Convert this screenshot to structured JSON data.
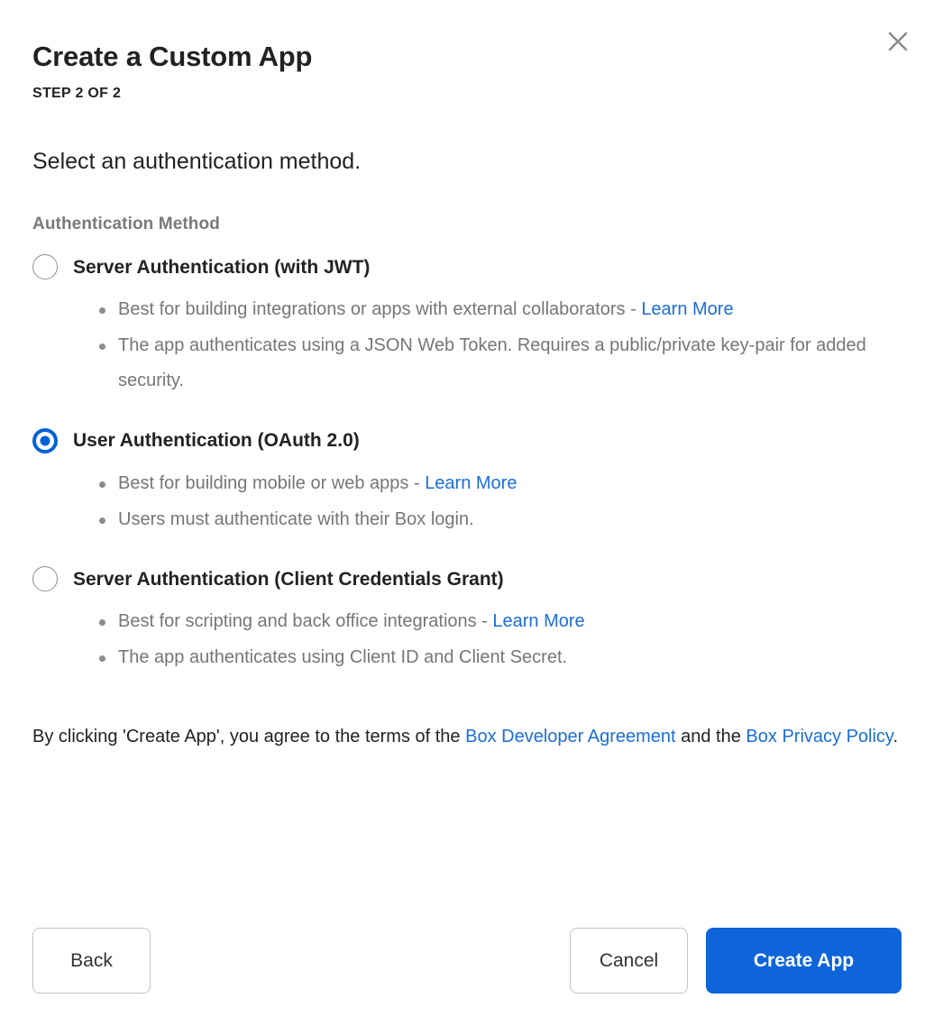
{
  "dialog": {
    "title": "Create a Custom App",
    "step": "STEP 2 OF 2",
    "subtitle": "Select an authentication method.",
    "close_icon": "close-icon"
  },
  "form": {
    "field_label": "Authentication Method",
    "options": [
      {
        "label": "Server Authentication (with JWT)",
        "selected": false,
        "bullets": [
          {
            "text_before": "Best for building integrations or apps with external collaborators - ",
            "link": "Learn More",
            "text_after": ""
          },
          {
            "text_before": "The app authenticates using a JSON Web Token. Requires a public/private key-pair for added security.",
            "link": "",
            "text_after": ""
          }
        ]
      },
      {
        "label": "User Authentication (OAuth 2.0)",
        "selected": true,
        "bullets": [
          {
            "text_before": "Best for building mobile or web apps - ",
            "link": "Learn More",
            "text_after": ""
          },
          {
            "text_before": "Users must authenticate with their Box login.",
            "link": "",
            "text_after": ""
          }
        ]
      },
      {
        "label": "Server Authentication (Client Credentials Grant)",
        "selected": false,
        "bullets": [
          {
            "text_before": "Best for scripting and back office integrations - ",
            "link": "Learn More",
            "text_after": ""
          },
          {
            "text_before": "The app authenticates using Client ID and Client Secret.",
            "link": "",
            "text_after": ""
          }
        ]
      }
    ]
  },
  "terms": {
    "part1": "By clicking 'Create App', you agree to the terms of the ",
    "link1": "Box Developer Agreement",
    "part2": " and the ",
    "link2": "Box Privacy Policy",
    "part3": "."
  },
  "footer": {
    "back_label": "Back",
    "cancel_label": "Cancel",
    "create_label": "Create App"
  },
  "colors": {
    "accent": "#0061D5",
    "primary_button": "#0D65D9",
    "link": "#1A6ED8",
    "muted_text": "#767676",
    "label_text": "#7A7A7A"
  }
}
